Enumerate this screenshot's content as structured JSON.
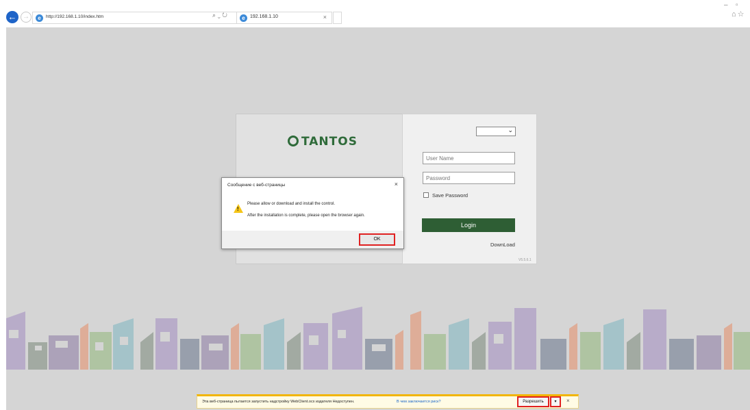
{
  "browser": {
    "address_url": "http://192.168.1.10/index.htm",
    "tab_title": "192.168.1.10",
    "search_glyph": "⌕",
    "refresh_glyph": "⌄ ↻",
    "tab_close_glyph": "×",
    "back_icon": "arrow-left-icon",
    "forward_icon": "arrow-right-icon",
    "minimize_glyph": "–",
    "maximize_glyph": "▫",
    "toolbar_glyphs": "⌂☆"
  },
  "login": {
    "brand": "TANTOS",
    "brand_color": "#2f6b3a",
    "language_value": "",
    "username_placeholder": "User Name",
    "password_placeholder": "Password",
    "save_password_label": "Save Password",
    "login_label": "Login",
    "download_label": "DownLoad",
    "version": "V5.5.6.1"
  },
  "dialog": {
    "title": "Сообщение с веб-страницы",
    "close_glyph": "×",
    "message_line1": "Please allow or download and install the control.",
    "message_line2": "After the installation is complete, please open the browser again.",
    "ok_label": "OK",
    "warning_icon": "warning-icon"
  },
  "notification": {
    "message": "Эта веб-страница пытается запустить надстройку WebClient.ocx издателя Недоступен.",
    "link": "В чем заключается риск?",
    "allow_label": "Разрешить",
    "menu_glyph": "▾",
    "close_glyph": "×",
    "accent_color": "#f2b500"
  }
}
